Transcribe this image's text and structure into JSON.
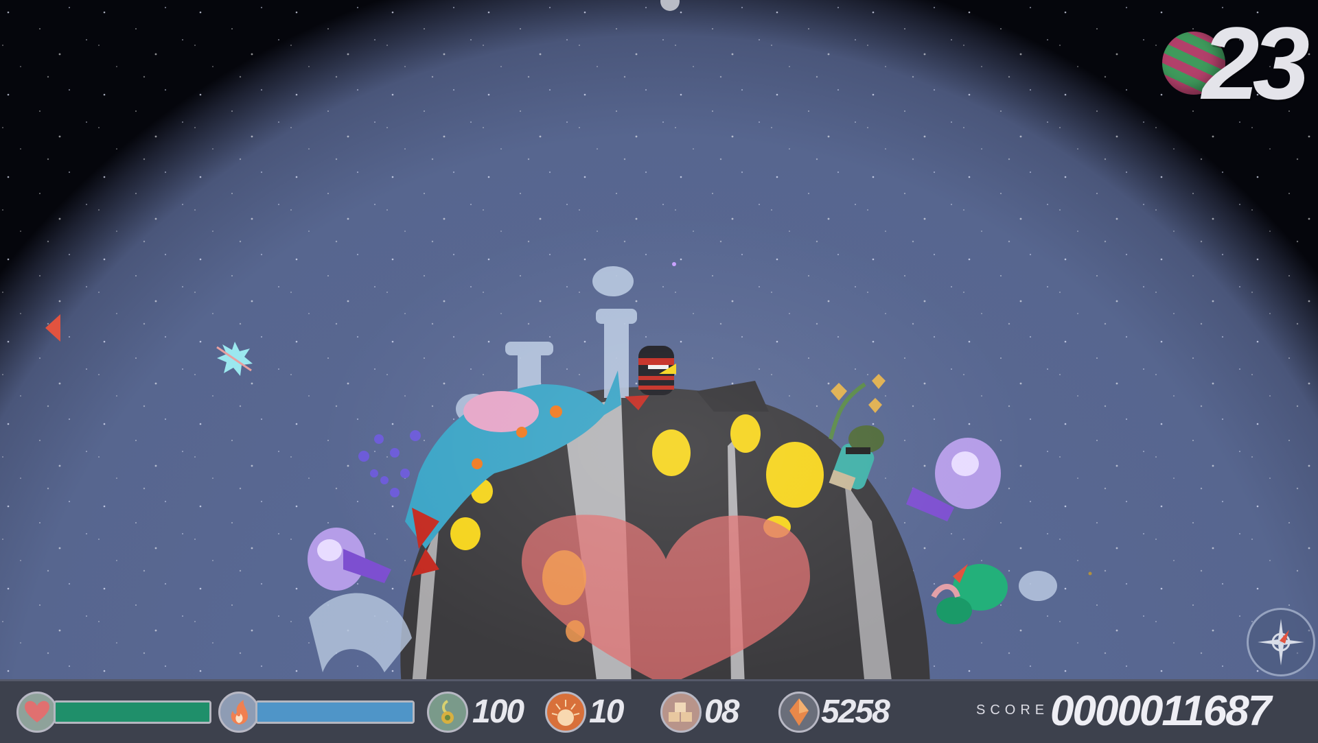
{
  "level": {
    "number": "23",
    "planet_icon": "striped-planet-icon"
  },
  "hud": {
    "health": {
      "icon": "heart-icon",
      "level": 1.0,
      "fill_color": "#1f8f6a"
    },
    "fuel": {
      "icon": "flame-icon",
      "level": 1.0,
      "fill_color": "#4f95c8"
    },
    "seeds": {
      "icon": "seed-icon",
      "value": "100"
    },
    "sun_energy": {
      "icon": "sun-icon",
      "value": "10"
    },
    "crates": {
      "icon": "crates-icon",
      "value": "08"
    },
    "gems": {
      "icon": "gem-icon",
      "value": "5258"
    },
    "score_label": "SCORE",
    "score_value": "0000011687"
  },
  "colors": {
    "atmosphere": "#5a6a96",
    "space": "#05060c",
    "planet_rock": "#3c3b3e",
    "heart_overlay": "#e07070",
    "hud_bg": "#3d414d"
  }
}
